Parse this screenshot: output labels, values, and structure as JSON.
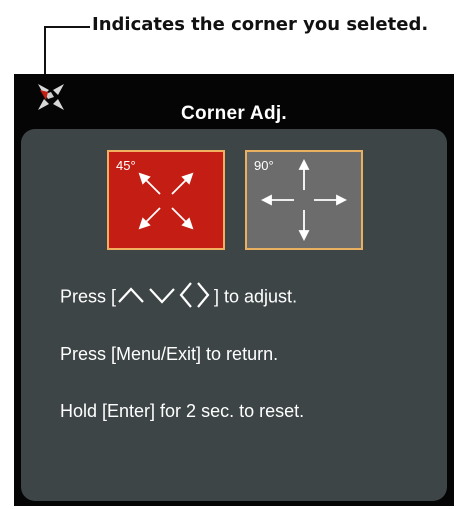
{
  "annotation": {
    "text": "Indicates the corner you seleted."
  },
  "osd": {
    "title": "Corner Adj.",
    "icons": {
      "corner": "corner-indicator-icon"
    },
    "modes": [
      {
        "label": "45°",
        "selected": true,
        "color": "#c41e14",
        "icon": "diagonal-arrows-icon"
      },
      {
        "label": "90°",
        "selected": false,
        "color": "#6c6c6c",
        "icon": "cross-arrows-icon"
      }
    ],
    "instructions": {
      "adjust_prefix": "Press [",
      "adjust_suffix": "] to adjust.",
      "return": "Press [Menu/Exit] to return.",
      "reset": "Hold [Enter] for 2 sec. to reset."
    },
    "colors": {
      "panel_background": "#050505",
      "body_background": "#3d4546",
      "selected_box": "#c41e14",
      "unselected_box": "#6c6c6c",
      "box_border": "#f0b060"
    }
  }
}
